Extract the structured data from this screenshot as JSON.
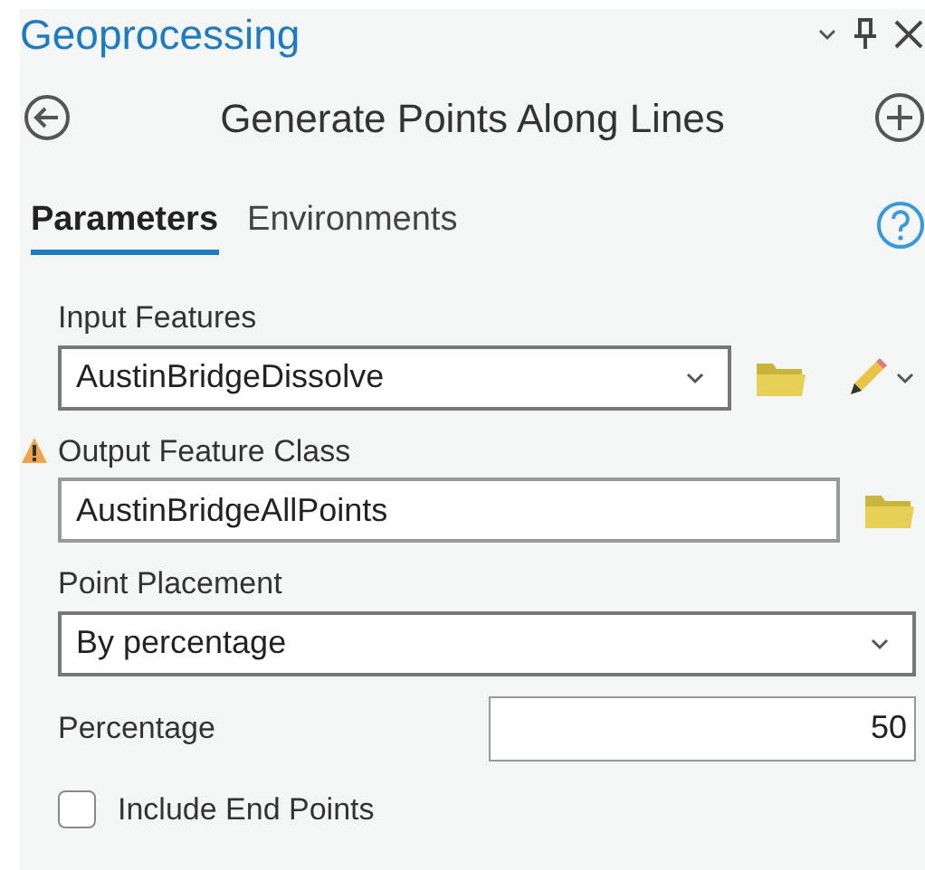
{
  "pane": {
    "title": "Geoprocessing"
  },
  "tool": {
    "title": "Generate Points Along Lines"
  },
  "tabs": [
    {
      "label": "Parameters",
      "selected": true
    },
    {
      "label": "Environments",
      "selected": false
    }
  ],
  "parameters": [
    {
      "kind": "dropdown",
      "label": "Input Features",
      "value": "AustinBridgeDissolve",
      "buttons": [
        {
          "kind": "browse"
        },
        {
          "kind": "edit"
        }
      ]
    },
    {
      "kind": "text",
      "label": "Output Feature Class",
      "value": "AustinBridgeAllPoints",
      "alerts": [
        {
          "kind": "warning"
        }
      ],
      "buttons": [
        {
          "kind": "browse"
        }
      ]
    },
    {
      "kind": "dropdown",
      "label": "Point Placement",
      "value": "By percentage"
    },
    {
      "kind": "number",
      "label": "Percentage",
      "value": "50"
    },
    {
      "kind": "checkbox",
      "label": "Include End Points",
      "checked": false
    }
  ]
}
